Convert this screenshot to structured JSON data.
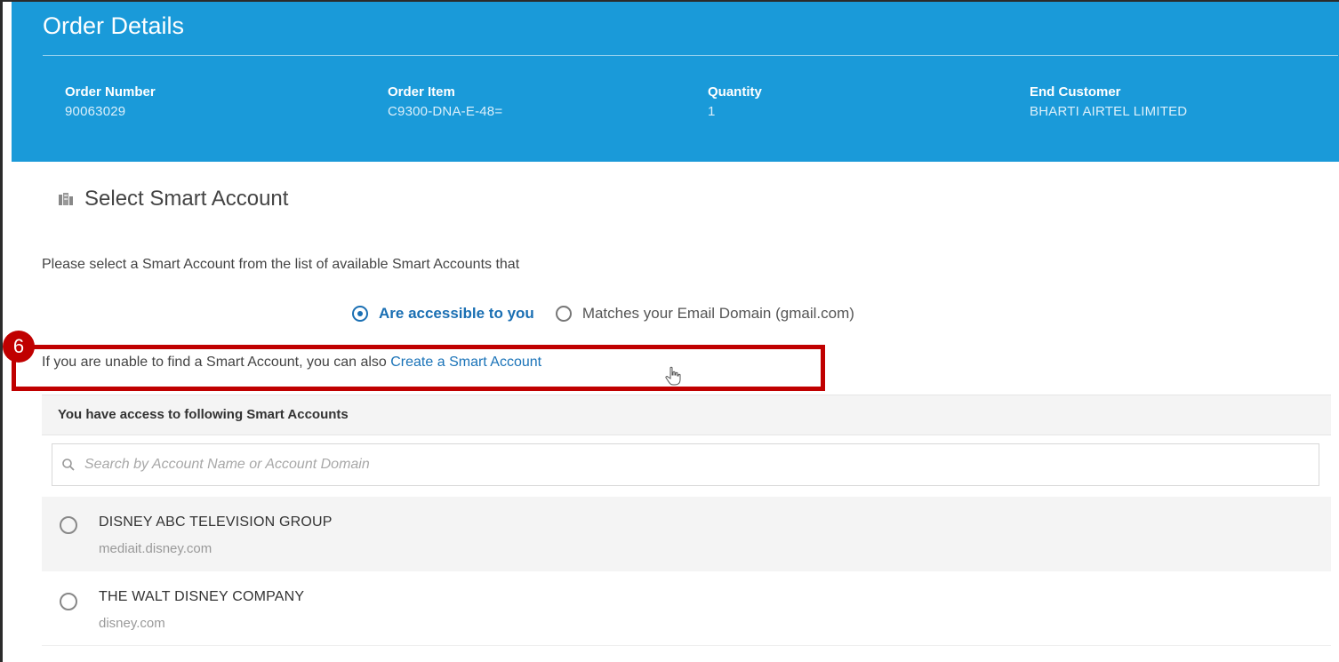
{
  "header": {
    "title": "Order Details",
    "fields": [
      {
        "label": "Order Number",
        "value": "90063029"
      },
      {
        "label": "Order Item",
        "value": "C9300-DNA-E-48="
      },
      {
        "label": "Quantity",
        "value": "1"
      },
      {
        "label": "End Customer",
        "value": "BHARTI AIRTEL LIMITED"
      }
    ],
    "color": "#1a9ad9"
  },
  "section": {
    "title": "Select Smart Account",
    "icon": "building-icon",
    "instruction": "Please select a Smart Account from the list of available Smart Accounts that",
    "filter": {
      "options": [
        {
          "label": "Are accessible to you",
          "selected": true
        },
        {
          "label": "Matches your Email Domain (gmail.com)",
          "selected": false
        }
      ]
    },
    "create_prefix": "If you are unable to find a Smart Account, you can also",
    "create_link": "Create a Smart Account"
  },
  "annotation": {
    "badge": "6",
    "color": "#c00000"
  },
  "accounts": {
    "header": "You have access to following Smart Accounts",
    "search_placeholder": "Search by Account Name or Account Domain",
    "items": [
      {
        "name": "DISNEY ABC TELEVISION GROUP",
        "domain": "mediait.disney.com"
      },
      {
        "name": "THE WALT DISNEY COMPANY",
        "domain": "disney.com"
      }
    ]
  }
}
